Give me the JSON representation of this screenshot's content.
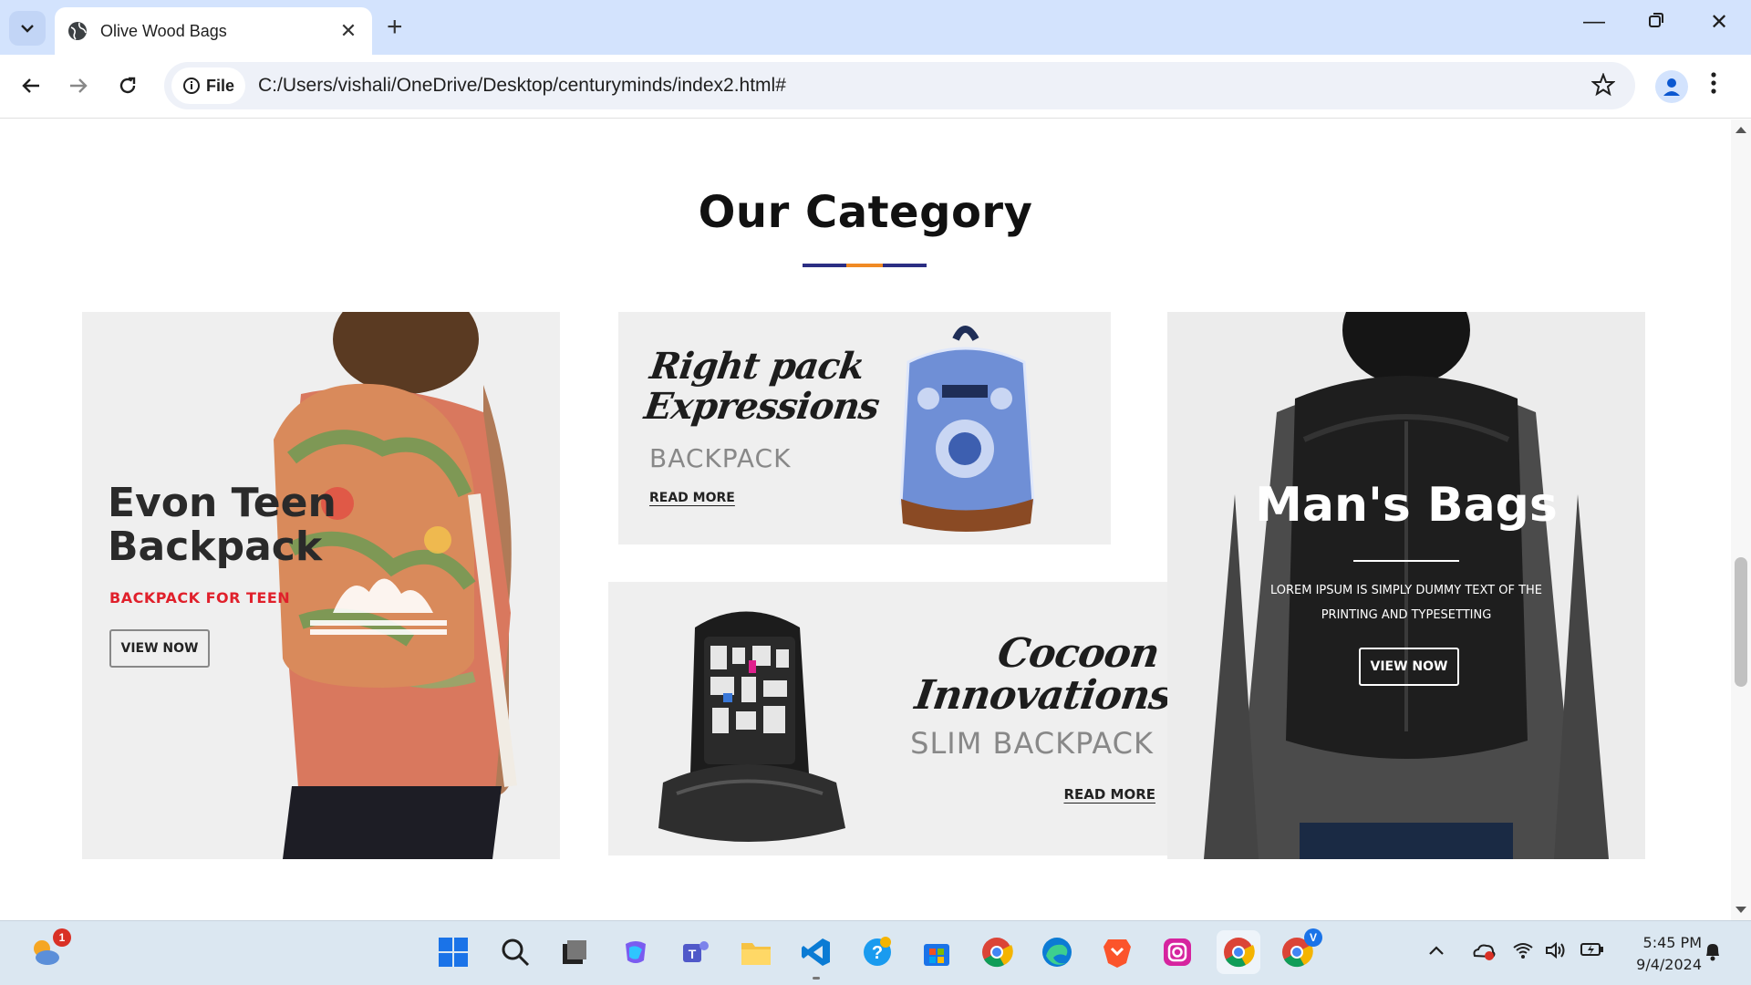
{
  "browser": {
    "tab_title": "Olive Wood Bags",
    "url_scheme_label": "File",
    "url": "C:/Users/vishali/OneDrive/Desktop/centuryminds/index2.html#"
  },
  "page": {
    "section_title": "Our Category",
    "accent_colors": {
      "navy": "#2b2e83",
      "orange": "#f08a24",
      "red": "#e0202b"
    },
    "cards": [
      {
        "title": "Evon Teen Backpack",
        "subtitle": "BACKPACK FOR TEEN",
        "button": "VIEW NOW"
      },
      {
        "title": "Right pack Expressions",
        "subtitle": "BACKPACK",
        "link": "READ MORE"
      },
      {
        "title": "Cocoon Innovations",
        "subtitle": "SLIM BACKPACK",
        "link": "READ MORE"
      },
      {
        "title": "Man's Bags",
        "description": "LOREM IPSUM IS SIMPLY DUMMY TEXT OF THE PRINTING AND TYPESETTING",
        "button": "VIEW NOW"
      }
    ]
  },
  "taskbar": {
    "weather_badge": "1",
    "teams_badge": "V",
    "time": "5:45 PM",
    "date": "9/4/2024",
    "apps": [
      "start-icon",
      "search-icon",
      "task-view-icon",
      "copilot-icon",
      "teams-icon",
      "file-explorer-icon",
      "vscode-icon",
      "help-icon",
      "store-icon",
      "chrome-icon",
      "edge-icon",
      "brave-icon",
      "instagram-icon",
      "chrome-active-icon",
      "chrome-profile-icon"
    ]
  }
}
